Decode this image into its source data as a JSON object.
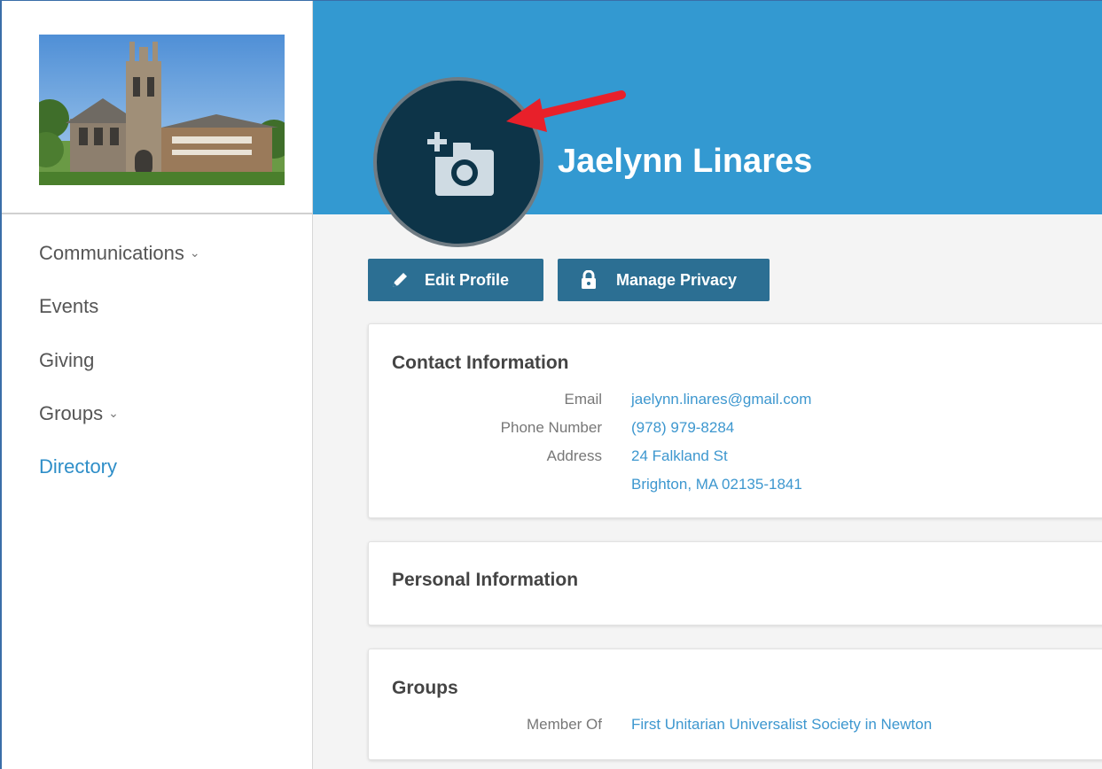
{
  "sidebar": {
    "items": [
      {
        "label": "Communications",
        "has_chevron": true
      },
      {
        "label": "Events"
      },
      {
        "label": "Giving"
      },
      {
        "label": "Groups",
        "has_chevron": true
      },
      {
        "label": "Directory",
        "active": true
      }
    ],
    "chevron_glyph": "⌄"
  },
  "profile": {
    "name": "Jaelynn Linares",
    "avatar_icon": "add-photo-icon"
  },
  "buttons": {
    "edit_profile": "Edit Profile",
    "manage_privacy": "Manage Privacy"
  },
  "contact": {
    "title": "Contact Information",
    "email_label": "Email",
    "email": "jaelynn.linares@gmail.com",
    "phone_label": "Phone Number",
    "phone": "(978) 979-8284",
    "address_label": "Address",
    "address_line1": "24 Falkland St",
    "address_line2": "Brighton, MA 02135-1841"
  },
  "personal": {
    "title": "Personal Information"
  },
  "groups": {
    "title": "Groups",
    "member_of_label": "Member Of",
    "member_of": "First Unitarian Universalist Society in Newton"
  },
  "colors": {
    "banner": "#3399d1",
    "avatar": "#0d3448",
    "button": "#2c6f93",
    "link": "#3d97cf",
    "active_nav": "#2e8ec8",
    "annotation_arrow": "#e8202a"
  }
}
